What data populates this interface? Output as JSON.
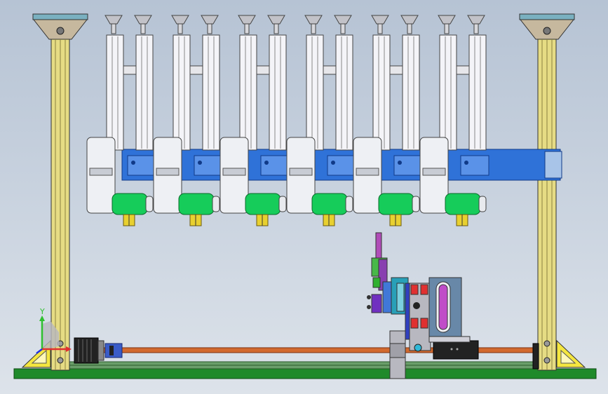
{
  "viewport": {
    "background_top": "#b6c3d4",
    "background_bottom": "#dde3ea"
  },
  "triad": {
    "y_label": "Y",
    "x_color": "#e03030",
    "y_color": "#30c030",
    "z_color": "#2030e0"
  },
  "module_count": 6,
  "colors": {
    "frame_post": "#e6dc84",
    "bracket": "#c6b89e",
    "base_plate": "#1f8a2a",
    "carriage": "#2f72d8",
    "motor_cap": "#16cc5a",
    "connector": "#e8d030",
    "lead_screw": "#d26a2e",
    "rod_housing": "#f4f4f8",
    "suction_cup": "#c2c2c8",
    "stand": "#b8b8c0"
  }
}
